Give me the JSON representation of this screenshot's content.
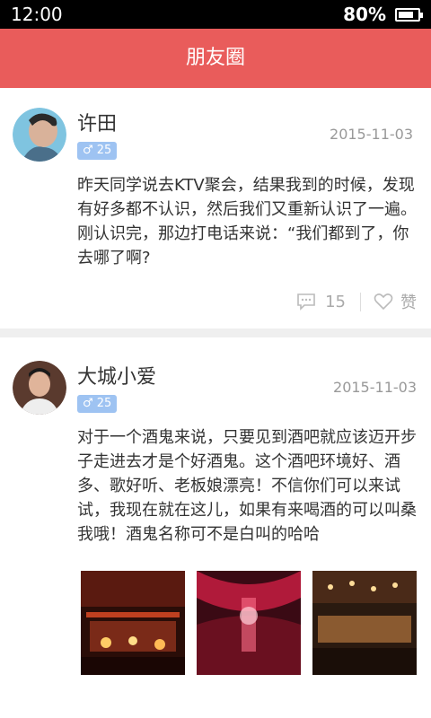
{
  "status_bar": {
    "time": "12:00",
    "battery_text": "80%",
    "battery_level": 0.8
  },
  "header": {
    "title": "朋友圈"
  },
  "posts": [
    {
      "name": "许田",
      "badge": "♂ 25",
      "date": "2015-11-03",
      "text": "昨天同学说去KTV聚会，结果我到的时候，发现有好多都不认识，然后我们又重新认识了一遍。 刚认识完，那边打电话来说：“我们都到了，你去哪了啊?",
      "comment_count": "15",
      "like_label": "赞"
    },
    {
      "name": "大城小爱",
      "badge": "♂ 25",
      "date": "2015-11-03",
      "text": "对于一个酒鬼来说，只要见到酒吧就应该迈开步子走进去才是个好酒鬼。这个酒吧环境好、酒多、歌好听、老板娘漂亮！不信你们可以来试试，我现在就在这儿，如果有来喝酒的可以叫桑我哦！酒鬼名称可不是白叫的哈哈",
      "photo_count": 3
    }
  ],
  "icons": {
    "comment": "comment-icon",
    "like": "heart-icon",
    "gender": "male-icon"
  }
}
